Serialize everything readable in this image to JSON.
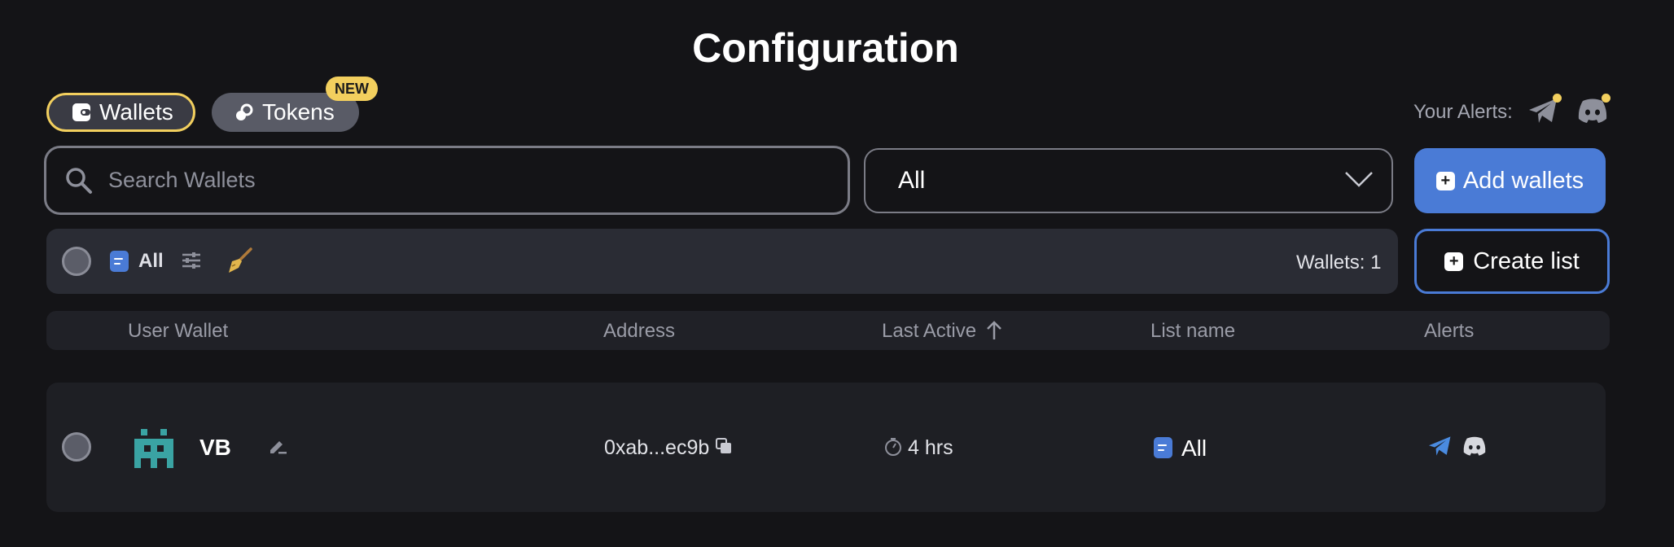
{
  "page": {
    "title": "Configuration"
  },
  "tabs": {
    "wallets_label": "Wallets",
    "tokens_label": "Tokens",
    "tokens_badge": "NEW"
  },
  "alerts": {
    "label": "Your Alerts:",
    "icons": [
      "telegram-icon",
      "discord-icon"
    ]
  },
  "search": {
    "placeholder": "Search Wallets",
    "value": ""
  },
  "list_select": {
    "selected": "All"
  },
  "buttons": {
    "add_wallets": "Add wallets",
    "create_list": "Create list"
  },
  "filter_bar": {
    "list_label": "All",
    "wallet_count": "Wallets: 1"
  },
  "table": {
    "columns": [
      "User Wallet",
      "Address",
      "Last Active",
      "List name",
      "Alerts"
    ],
    "rows": [
      {
        "name": "VB",
        "address": "0xab...ec9b",
        "last_active": "4 hrs",
        "list_name": "All",
        "alerts": [
          "telegram-icon",
          "discord-icon"
        ]
      }
    ]
  },
  "colors": {
    "background": "#141417",
    "accent_blue": "#4a7bd6",
    "accent_yellow": "#f2cf5e",
    "avatar_teal": "#3aa3a3"
  }
}
